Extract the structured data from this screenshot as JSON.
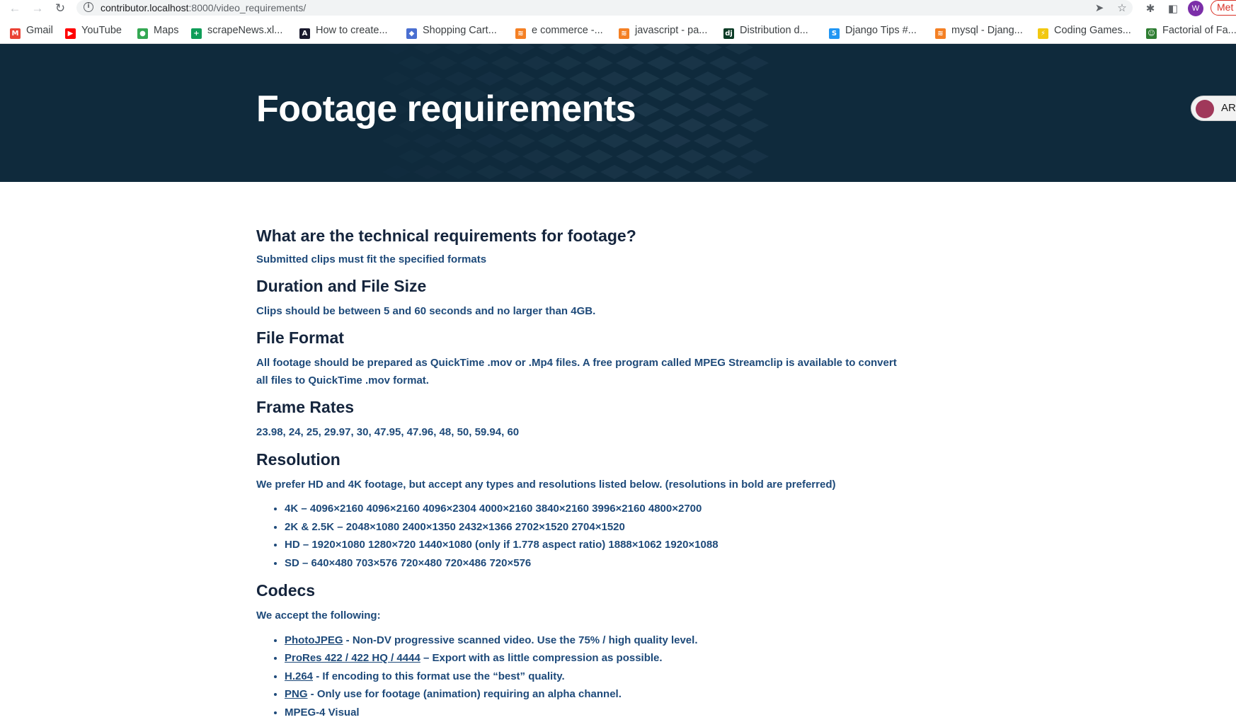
{
  "browser": {
    "url_host": "contributor.localhost",
    "url_rest": ":8000/video_requirements/",
    "profile_initial": "W",
    "update_label": "Met",
    "bookmarks": [
      {
        "label": "Gmail",
        "icon": "gmail-icon",
        "color": "#ea4335",
        "glyph": "M"
      },
      {
        "label": "YouTube",
        "icon": "youtube-icon",
        "color": "#ff0000",
        "glyph": "▶"
      },
      {
        "label": "Maps",
        "icon": "maps-pin-icon",
        "color": "#34a853",
        "glyph": "●"
      },
      {
        "label": "scrapeNews.xl...",
        "icon": "sheets-icon",
        "color": "#0f9d58",
        "glyph": "+"
      },
      {
        "label": "How to create...",
        "icon": "site-a-icon",
        "color": "#1a1a2e",
        "glyph": "A"
      },
      {
        "label": "Shopping Cart...",
        "icon": "code-icon",
        "color": "#4a6fd1",
        "glyph": "◆"
      },
      {
        "label": "e commerce -...",
        "icon": "stackoverflow-icon",
        "color": "#f48024",
        "glyph": "≋"
      },
      {
        "label": "javascript - pa...",
        "icon": "stackoverflow-icon",
        "color": "#f48024",
        "glyph": "≋"
      },
      {
        "label": "Distribution d...",
        "icon": "django-icon",
        "color": "#0c3c26",
        "glyph": "dj"
      },
      {
        "label": "Django Tips #...",
        "icon": "s-icon",
        "color": "#2196f3",
        "glyph": "S"
      },
      {
        "label": "mysql - Djang...",
        "icon": "stackoverflow-icon",
        "color": "#f48024",
        "glyph": "≋"
      },
      {
        "label": "Coding Games...",
        "icon": "coding-games-icon",
        "color": "#f2c811",
        "glyph": "⚡"
      },
      {
        "label": "Factorial of Fa...",
        "icon": "factorial-icon",
        "color": "#2e7d32",
        "glyph": "☺"
      }
    ]
  },
  "hero": {
    "title": "Footage requirements",
    "toggle_label": "AR"
  },
  "content": {
    "q_heading": "What are the technical requirements for footage?",
    "q_text": "Submitted clips must fit the specified formats",
    "duration_heading": "Duration and File Size",
    "duration_text": "Clips should be between 5 and 60 seconds and no larger than 4GB.",
    "format_heading": "File Format",
    "format_text": "All footage should be prepared as QuickTime .mov or .Mp4 files. A free program called MPEG Streamclip is available to convert all files to QuickTime .mov format.",
    "framerates_heading": "Frame Rates",
    "framerates_text": "23.98, 24, 25, 29.97, 30, 47.95, 47.96, 48, 50, 59.94, 60",
    "resolution_heading": "Resolution",
    "resolution_text": "We prefer HD and 4K footage, but accept any types and resolutions listed below. (resolutions in bold are preferred)",
    "resolutions": [
      "4K – 4096×2160 4096×2160 4096×2304 4000×2160 3840×2160 3996×2160 4800×2700",
      "2K & 2.5K – 2048×1080 2400×1350 2432×1366 2702×1520 2704×1520",
      "HD – 1920×1080 1280×720 1440×1080 (only if 1.778 aspect ratio) 1888×1062 1920×1088",
      "SD –  640×480 703×576 720×480 720×486 720×576"
    ],
    "codecs_heading": "Codecs",
    "codecs_text": "We accept the following:",
    "codecs": [
      {
        "link": "PhotoJPEG",
        "desc": " - Non-DV progressive scanned video. Use the 75% / high quality level."
      },
      {
        "link": "ProRes 422 / 422 HQ / 4444",
        "desc": " – Export with as little compression as possible."
      },
      {
        "link": "H.264",
        "desc": " - If encoding to this format use the “best” quality."
      },
      {
        "link": "PNG",
        "desc": " - Only use for footage (animation) requiring an alpha channel."
      },
      {
        "link": "",
        "desc": "MPEG-4 Visual"
      }
    ]
  }
}
